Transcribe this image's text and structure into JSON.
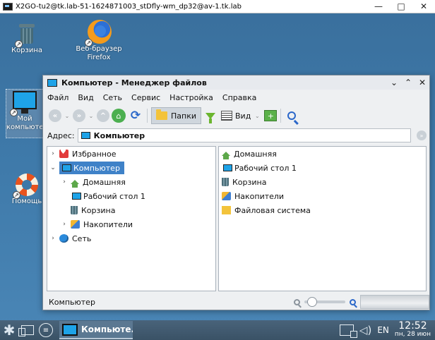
{
  "host_window": {
    "title": "X2GO-tu2@tk.lab-51-1624871003_stDfly-wm_dp32@av-1.tk.lab",
    "controls": [
      "—",
      "□",
      "✕"
    ]
  },
  "desktop": {
    "icons": [
      {
        "label": "Корзина",
        "icon": "trash-icon"
      },
      {
        "label": "Веб-браузер\nFirefox",
        "line1": "Веб-браузер",
        "line2": "Firefox",
        "icon": "firefox-icon"
      },
      {
        "line1": "Мой",
        "line2": "компьюте",
        "icon": "computer-icon"
      },
      {
        "label": "Помощь",
        "icon": "help-icon"
      }
    ]
  },
  "file_manager": {
    "title": "Компьютер - Менеджер файлов",
    "window_controls": [
      "⌄",
      "⌃",
      "✕"
    ],
    "menu": [
      "Файл",
      "Вид",
      "Сеть",
      "Сервис",
      "Настройка",
      "Справка"
    ],
    "toolbar": {
      "folders_label": "Папки",
      "view_label": "Вид",
      "back_glyph": "«",
      "forward_glyph": "»",
      "up_glyph": "^",
      "home_glyph": "⌂",
      "reload_glyph": "⟳",
      "add_pane_glyph": "+"
    },
    "address": {
      "label": "Адрес:",
      "value": "Компьютер"
    },
    "tree": [
      {
        "label": "Избранное",
        "icon": "favorites-icon",
        "expander": "›"
      },
      {
        "label": "Компьютер",
        "icon": "computer-icon",
        "expander": "⌄",
        "selected": true
      },
      {
        "label": "Домашняя",
        "icon": "home-icon",
        "expander": "›"
      },
      {
        "label": "Рабочий стол 1",
        "icon": "desktop-icon",
        "expander": ""
      },
      {
        "label": "Корзина",
        "icon": "trash-icon",
        "expander": ""
      },
      {
        "label": "Накопители",
        "icon": "drives-icon",
        "expander": "›"
      },
      {
        "label": "Сеть",
        "icon": "network-icon",
        "expander": "›"
      }
    ],
    "files": [
      {
        "label": "Домашняя",
        "icon": "home-icon"
      },
      {
        "label": "Рабочий стол 1",
        "icon": "desktop-icon"
      },
      {
        "label": "Корзина",
        "icon": "trash-icon"
      },
      {
        "label": "Накопители",
        "icon": "drives-icon"
      },
      {
        "label": "Файловая система",
        "icon": "folder-icon"
      }
    ],
    "status_text": "Компьютер",
    "zoom_level": 0.1
  },
  "taskbar": {
    "task_label": "Компьюте...",
    "language": "EN",
    "time": "12:52",
    "date": "пн, 28 июн"
  },
  "colors": {
    "desktop": "#3d78a8",
    "selection": "#3f82c8",
    "taskbar": "#3a5266"
  }
}
